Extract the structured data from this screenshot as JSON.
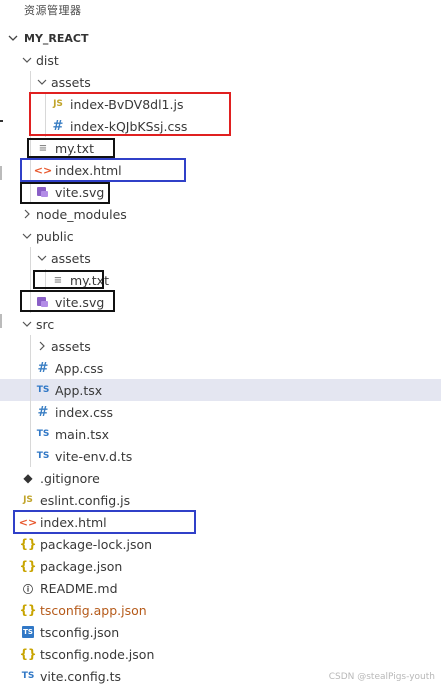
{
  "panel_title": "资源管理器",
  "project": {
    "name": "MY_REACT"
  },
  "tree": [
    {
      "label": "dist",
      "kind": "folder",
      "open": true,
      "depth": 0
    },
    {
      "label": "assets",
      "kind": "folder",
      "open": true,
      "depth": 1
    },
    {
      "label": "index-BvDV8dl1.js",
      "kind": "js",
      "depth": 2
    },
    {
      "label": "index-kQJbKSsj.css",
      "kind": "css",
      "depth": 2
    },
    {
      "label": "my.txt",
      "kind": "txt",
      "depth": 1
    },
    {
      "label": "index.html",
      "kind": "html",
      "depth": 1
    },
    {
      "label": "vite.svg",
      "kind": "svg",
      "depth": 1
    },
    {
      "label": "node_modules",
      "kind": "folder",
      "open": false,
      "depth": 0
    },
    {
      "label": "public",
      "kind": "folder",
      "open": true,
      "depth": 0
    },
    {
      "label": "assets",
      "kind": "folder",
      "open": true,
      "depth": 1
    },
    {
      "label": "my.txt",
      "kind": "txt",
      "depth": 2
    },
    {
      "label": "vite.svg",
      "kind": "svg",
      "depth": 1
    },
    {
      "label": "src",
      "kind": "folder",
      "open": true,
      "depth": 0
    },
    {
      "label": "assets",
      "kind": "folder",
      "open": false,
      "depth": 1
    },
    {
      "label": "App.css",
      "kind": "css",
      "depth": 1
    },
    {
      "label": "App.tsx",
      "kind": "ts",
      "depth": 1,
      "selected": true
    },
    {
      "label": "index.css",
      "kind": "css",
      "depth": 1
    },
    {
      "label": "main.tsx",
      "kind": "ts",
      "depth": 1
    },
    {
      "label": "vite-env.d.ts",
      "kind": "ts",
      "depth": 1
    },
    {
      "label": ".gitignore",
      "kind": "git",
      "depth": 0
    },
    {
      "label": "eslint.config.js",
      "kind": "js",
      "depth": 0
    },
    {
      "label": "index.html",
      "kind": "html",
      "depth": 0
    },
    {
      "label": "package-lock.json",
      "kind": "braces",
      "depth": 0
    },
    {
      "label": "package.json",
      "kind": "braces",
      "depth": 0
    },
    {
      "label": "README.md",
      "kind": "info",
      "depth": 0
    },
    {
      "label": "tsconfig.app.json",
      "kind": "braces",
      "depth": 0,
      "warning": true
    },
    {
      "label": "tsconfig.json",
      "kind": "tsconfig",
      "depth": 0
    },
    {
      "label": "tsconfig.node.json",
      "kind": "braces",
      "depth": 0
    },
    {
      "label": "vite.config.ts",
      "kind": "ts",
      "depth": 0
    }
  ],
  "icons": {
    "js": "JS",
    "css": "#",
    "ts": "TS",
    "txt": "≡",
    "html": "<>",
    "braces": "{}",
    "git": "◆",
    "info": "ⓘ",
    "tsconfig": "TS"
  },
  "colors": {
    "highlight_red": "#e02020",
    "highlight_black": "#111111",
    "highlight_blue": "#3040c8",
    "selected_row": "#e4e6f1"
  },
  "watermark": "CSDN @stealPigs-youth"
}
